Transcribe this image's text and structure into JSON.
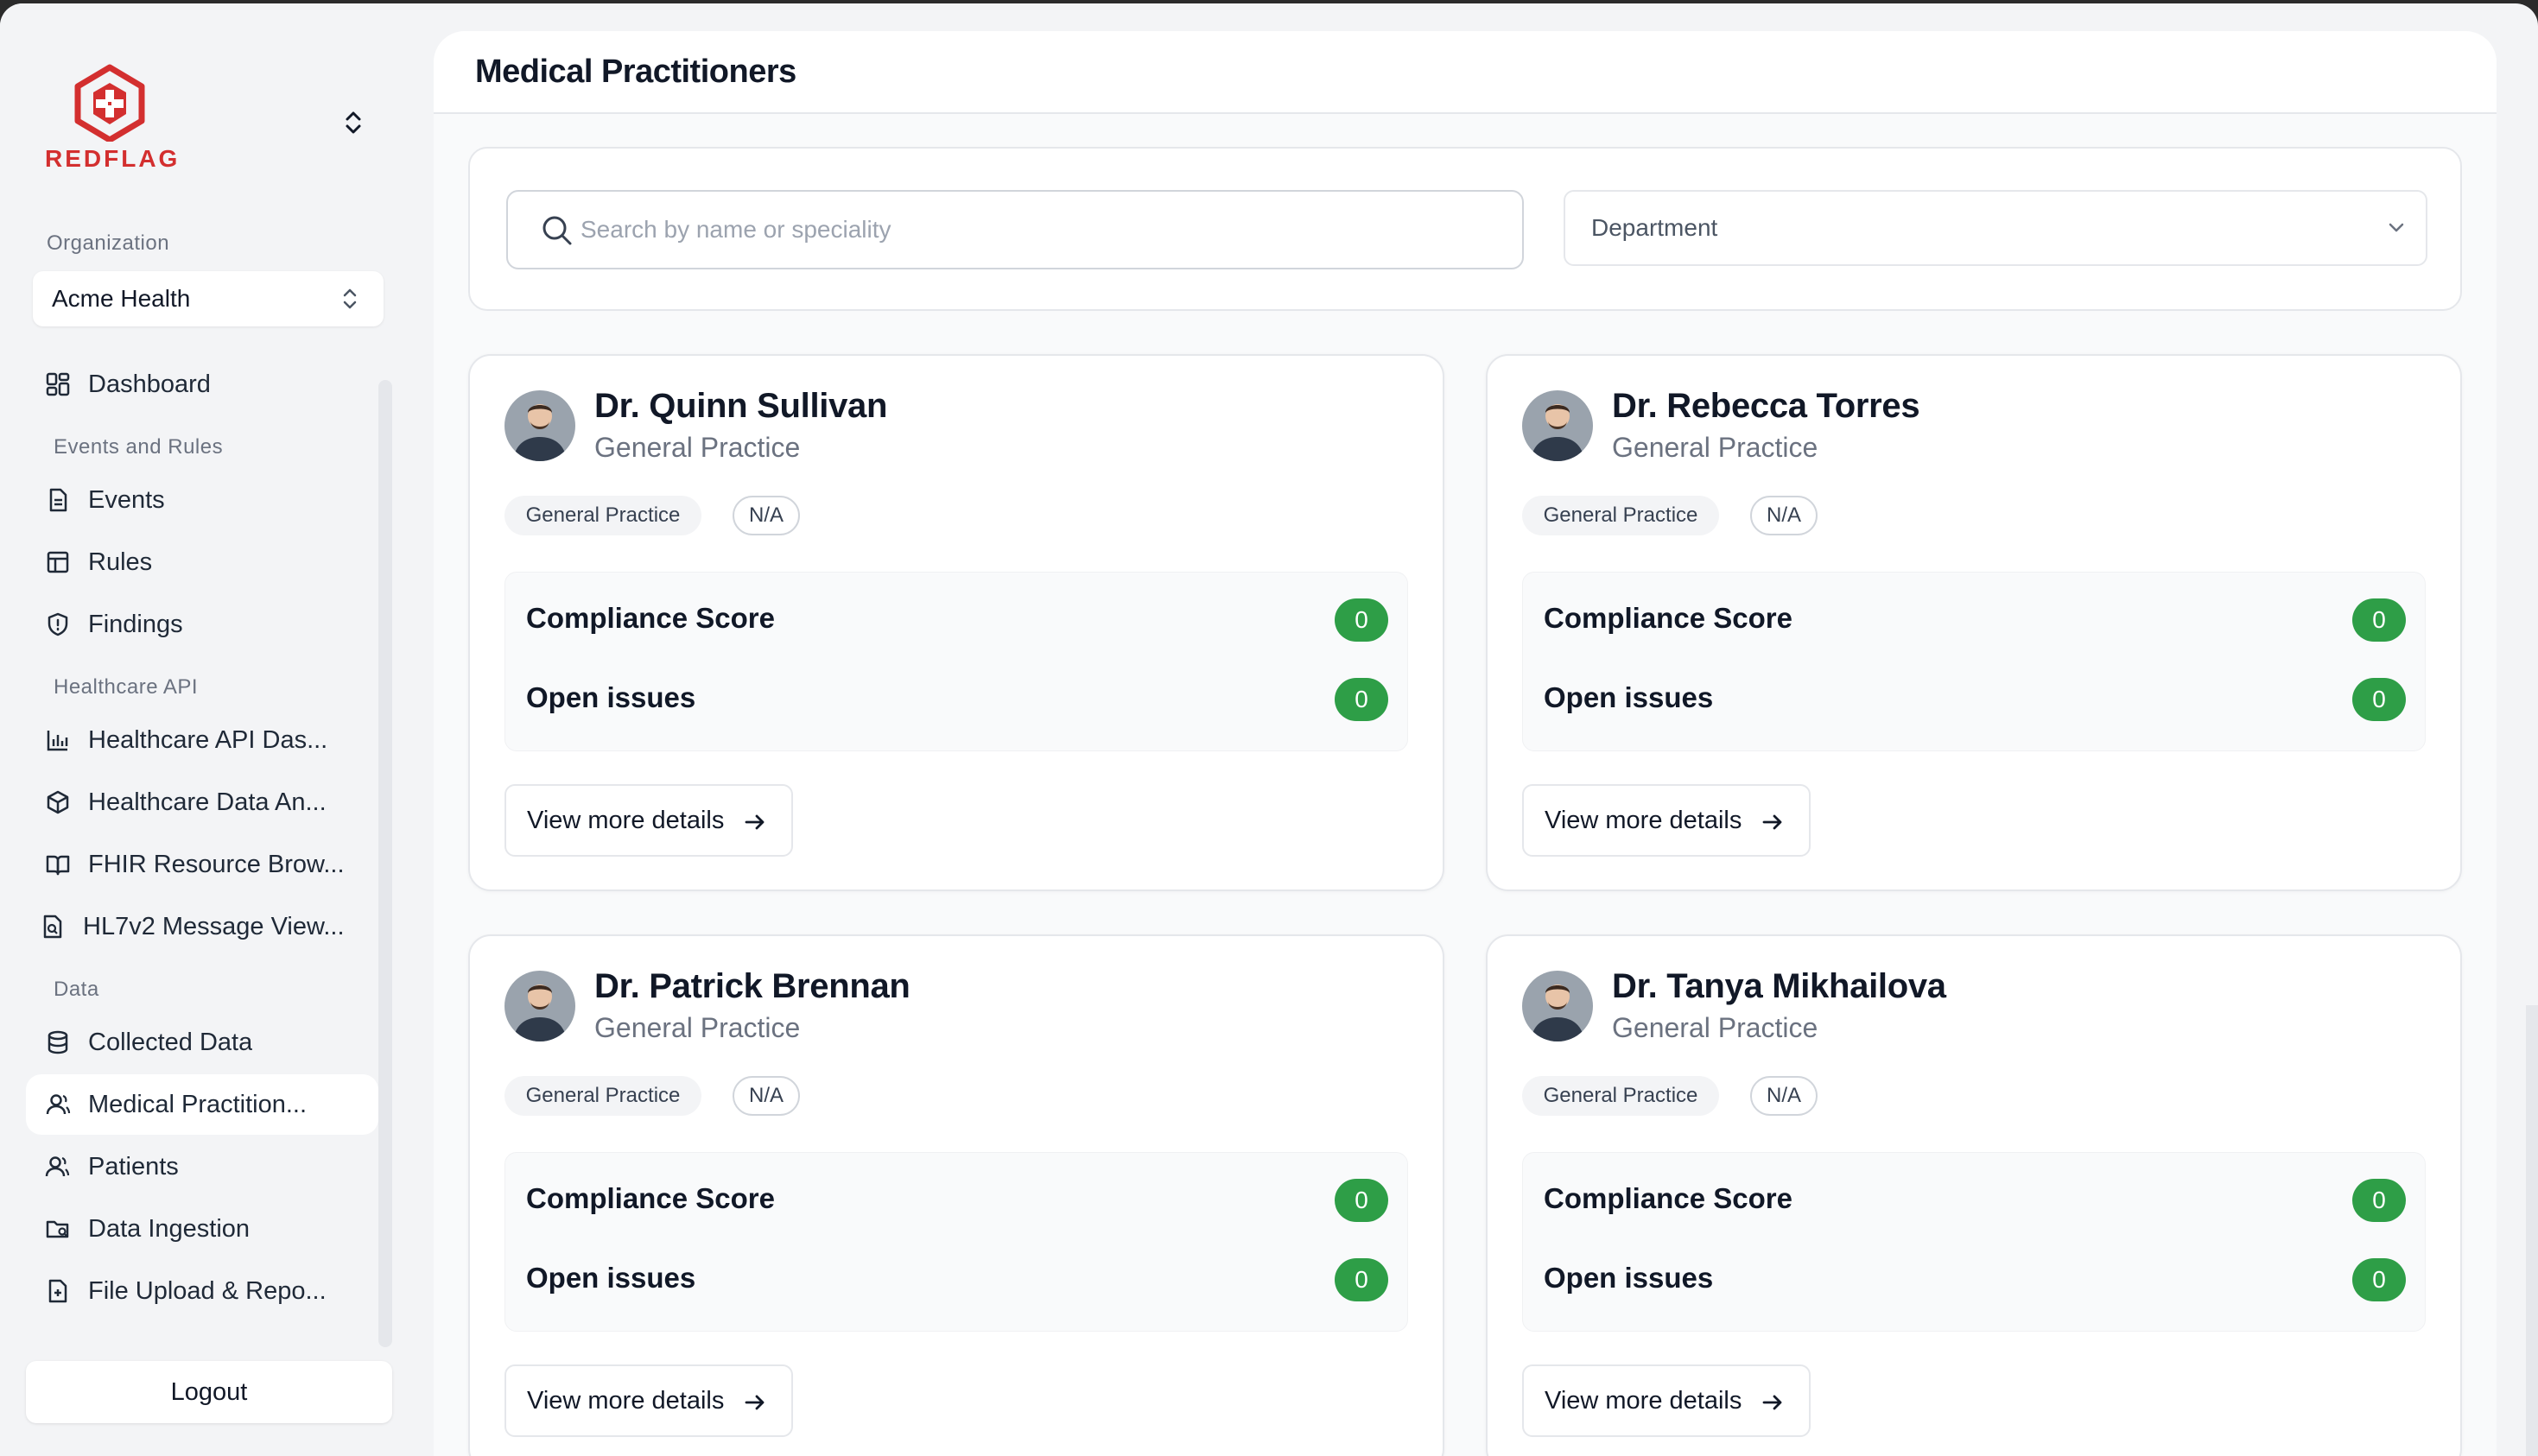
{
  "app": {
    "logo_text": "REDFLAG",
    "brand_color": "#d32f2f",
    "accent_green": "#2e9e47"
  },
  "sidebar": {
    "organization_label": "Organization",
    "organization_value": "Acme Health",
    "sections": {
      "events": "Events and Rules",
      "healthcare": "Healthcare API",
      "data": "Data"
    },
    "items": [
      {
        "label": "Dashboard",
        "icon": "dashboard-icon"
      },
      {
        "label": "Events",
        "icon": "file-icon"
      },
      {
        "label": "Rules",
        "icon": "table-icon"
      },
      {
        "label": "Findings",
        "icon": "shield-icon"
      },
      {
        "label": "Healthcare API Das...",
        "icon": "bar-chart-icon"
      },
      {
        "label": "Healthcare Data An...",
        "icon": "cube-icon"
      },
      {
        "label": "FHIR Resource Brow...",
        "icon": "book-icon"
      },
      {
        "label": "HL7v2 Message View...",
        "icon": "file-search-icon"
      },
      {
        "label": "Collected Data",
        "icon": "database-icon"
      },
      {
        "label": "Medical Practition...",
        "icon": "user-icon"
      },
      {
        "label": "Patients",
        "icon": "users-icon"
      },
      {
        "label": "Data Ingestion",
        "icon": "folder-search-icon"
      },
      {
        "label": "File Upload & Repo...",
        "icon": "file-plus-icon"
      }
    ],
    "logout_label": "Logout"
  },
  "main": {
    "title": "Medical Practitioners",
    "search_placeholder": "Search by name or speciality",
    "department_label": "Department",
    "cards": [
      {
        "name": "Dr. Quinn Sullivan",
        "specialty": "General Practice",
        "tag1": "General Practice",
        "tag2": "N/A",
        "compliance_label": "Compliance Score",
        "compliance_value": "0",
        "issues_label": "Open issues",
        "issues_value": "0",
        "button": "View more details"
      },
      {
        "name": "Dr. Rebecca Torres",
        "specialty": "General Practice",
        "tag1": "General Practice",
        "tag2": "N/A",
        "compliance_label": "Compliance Score",
        "compliance_value": "0",
        "issues_label": "Open issues",
        "issues_value": "0",
        "button": "View more details"
      },
      {
        "name": "Dr. Patrick Brennan",
        "specialty": "General Practice",
        "tag1": "General Practice",
        "tag2": "N/A",
        "compliance_label": "Compliance Score",
        "compliance_value": "0",
        "issues_label": "Open issues",
        "issues_value": "0",
        "button": "View more details"
      },
      {
        "name": "Dr. Tanya Mikhailova",
        "specialty": "General Practice",
        "tag1": "General Practice",
        "tag2": "N/A",
        "compliance_label": "Compliance Score",
        "compliance_value": "0",
        "issues_label": "Open issues",
        "issues_value": "0",
        "button": "View more details"
      }
    ]
  }
}
